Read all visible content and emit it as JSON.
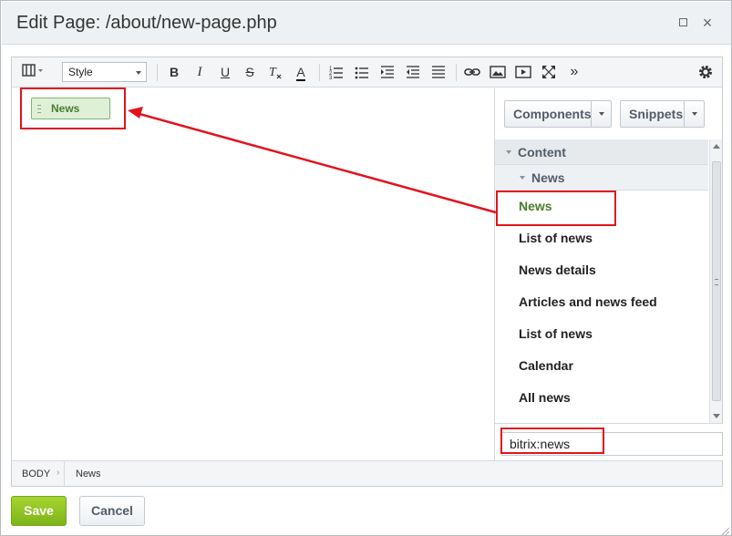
{
  "dialog": {
    "title": "Edit Page: /about/new-page.php",
    "maximize_icon": "maximize-icon",
    "close_icon": "close-icon",
    "close_glyph": "×"
  },
  "toolbar": {
    "style_select_value": "Style",
    "icons": [
      "view-mode-icon",
      "bold-icon",
      "italic-icon",
      "underline-icon",
      "strikethrough-icon",
      "remove-format-icon",
      "font-color-icon",
      "ordered-list-icon",
      "unordered-list-icon",
      "indent-icon",
      "outdent-icon",
      "align-icon",
      "link-icon",
      "image-icon",
      "video-icon",
      "fullscreen-icon",
      "more-icon",
      "settings-icon"
    ],
    "bold_glyph": "B",
    "italic_glyph": "I",
    "underline_glyph": "U",
    "strike_glyph": "S",
    "font_color_glyph": "A",
    "more_glyph": "»"
  },
  "content": {
    "component_chip_label": "News"
  },
  "panel": {
    "components_label": "Components",
    "snippets_label": "Snippets",
    "tree": {
      "group_label": "Content",
      "subgroup_label": "News",
      "items": [
        "News",
        "List of news",
        "News details",
        "Articles and news feed",
        "List of news",
        "Calendar",
        "All news"
      ]
    },
    "search_value": "bitrix:news"
  },
  "statusbar": {
    "crumbs": [
      "BODY",
      "News"
    ]
  },
  "footer": {
    "save_label": "Save",
    "cancel_label": "Cancel"
  },
  "colors": {
    "accent_green": "#7db519",
    "annotation_red": "#e0141e",
    "chip_green": "#4a7d2b"
  }
}
